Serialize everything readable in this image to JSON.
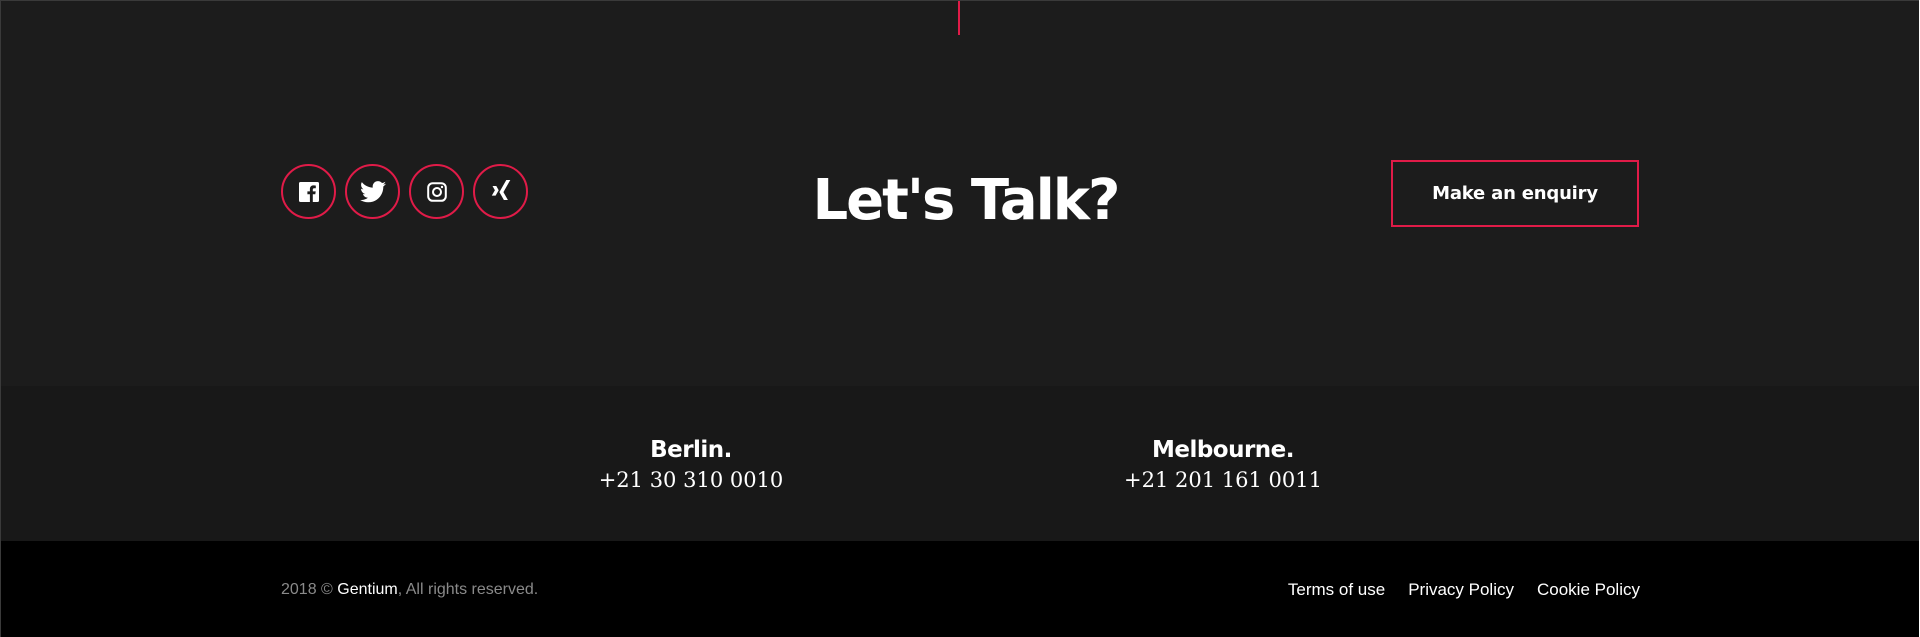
{
  "colors": {
    "accent": "#e01b48",
    "band_dark": "#1c1c1c",
    "band_darker": "#181818",
    "footer": "#000000",
    "text": "#ffffff",
    "muted": "#8a8a8a"
  },
  "contact": {
    "headline": "Let's Talk?",
    "cta_label": "Make an enquiry",
    "social": [
      {
        "icon": "facebook-icon",
        "label": "Facebook"
      },
      {
        "icon": "twitter-icon",
        "label": "Twitter"
      },
      {
        "icon": "instagram-icon",
        "label": "Instagram"
      },
      {
        "icon": "xing-icon",
        "label": "Xing"
      }
    ]
  },
  "offices": [
    {
      "city": "Berlin.",
      "phone": "+21 30 310 0010"
    },
    {
      "city": "Melbourne.",
      "phone": "+21 201 161 0011"
    }
  ],
  "footer": {
    "copyright_prefix": "2018 ©",
    "brand": "Gentium",
    "copyright_suffix": ", All rights reserved.",
    "links": [
      {
        "label": "Terms of use"
      },
      {
        "label": "Privacy Policy"
      },
      {
        "label": "Cookie Policy"
      }
    ]
  }
}
